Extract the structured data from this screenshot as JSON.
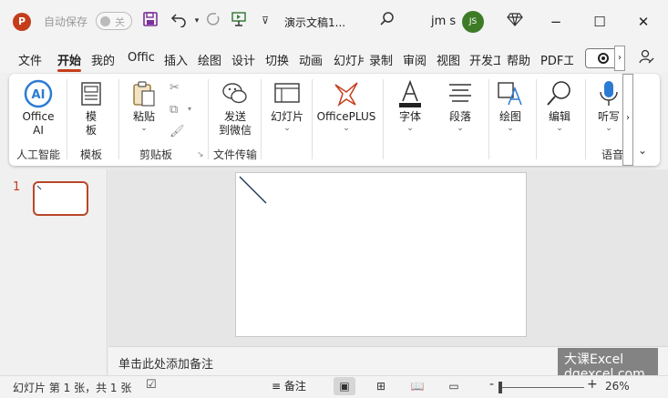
{
  "titlebar": {
    "app_icon_letter": "P",
    "autosave_label": "自动保存",
    "autosave_state": "关",
    "doc_title": "演示文稿1...",
    "user_name": "jm s",
    "user_initials": "JS",
    "icons": [
      "save-icon",
      "undo-icon",
      "redo-icon",
      "present-icon",
      "customize-icon",
      "search-icon",
      "diamond-icon",
      "minimize-icon",
      "maximize-icon",
      "close-icon"
    ]
  },
  "tabs": [
    "文件",
    "开始",
    "我的",
    "Offic",
    "插入",
    "绘图",
    "设计",
    "切换",
    "动画",
    "幻灯片",
    "录制",
    "审阅",
    "视图",
    "开发工",
    "帮助",
    "PDF工"
  ],
  "active_tab": "开始",
  "ribbon": {
    "office_ai": "Office AI",
    "office_ai_line1": "Office",
    "office_ai_line2": "AI",
    "group_ai": "人工智能",
    "template_line1": "模",
    "template_line2": "板",
    "group_template": "模板",
    "paste": "粘贴",
    "group_clipboard": "剪贴板",
    "send_line1": "发送",
    "send_line2": "到微信",
    "group_file_transfer": "文件传输",
    "slides": "幻灯片",
    "officeplus": "OfficePLUS",
    "font": "字体",
    "paragraph": "段落",
    "drawing": "绘图",
    "editing": "编辑",
    "dictate": "听写",
    "group_voice": "语音"
  },
  "pane": {
    "slide_number": "1"
  },
  "notes_placeholder": "单击此处添加备注",
  "watermark": {
    "line1": "大课Excel",
    "line2": "dqexcel.com"
  },
  "status": {
    "slide_info": "幻灯片 第 1 张，共 1 张",
    "notes_label": "备注",
    "zoom_minus": "-",
    "zoom_plus": "+",
    "zoom": "26%",
    "zoom_fraction": 0.26
  },
  "colors": {
    "accent": "#c43e1c",
    "avatar": "#3e7b27",
    "thumb_border": "#b8472a"
  }
}
